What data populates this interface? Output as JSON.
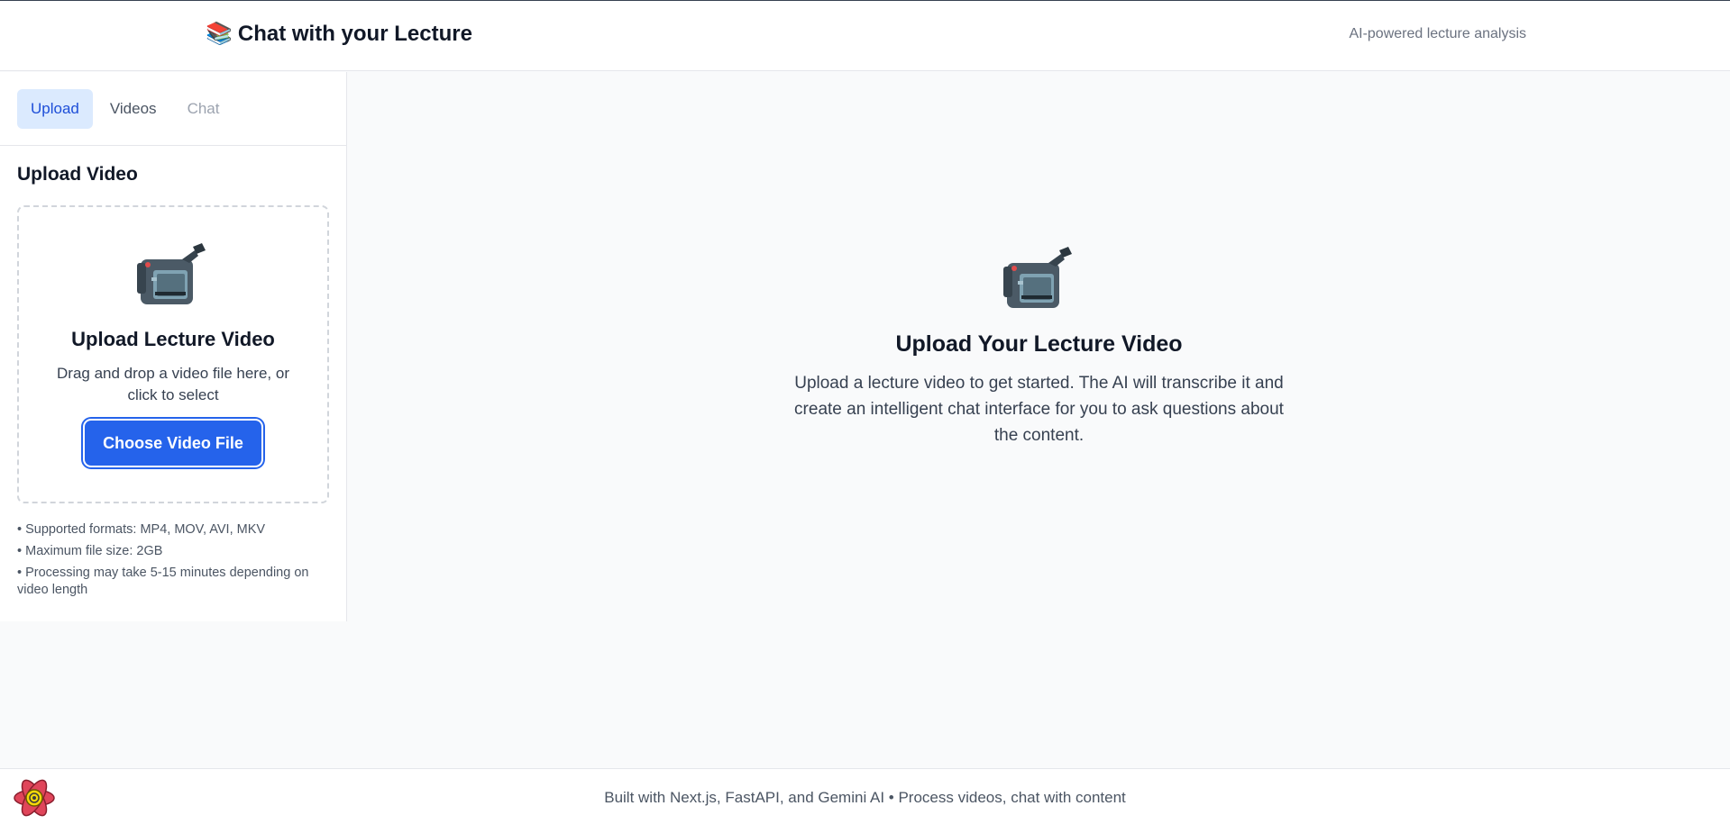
{
  "header": {
    "brand_emoji": "📚",
    "title": "Chat with your Lecture",
    "tagline": "AI-powered lecture analysis"
  },
  "sidebar": {
    "tabs": [
      {
        "label": "Upload",
        "state": "active"
      },
      {
        "label": "Videos",
        "state": "normal"
      },
      {
        "label": "Chat",
        "state": "disabled"
      }
    ],
    "upload": {
      "section_title": "Upload Video",
      "dropzone_icon": "video-camera-icon",
      "dropzone_title": "Upload Lecture Video",
      "dropzone_hint": "Drag and drop a video file here, or click to select",
      "button_label": "Choose Video File",
      "notes": [
        "Supported formats: MP4, MOV, AVI, MKV",
        "Maximum file size: 2GB",
        "Processing may take 5-15 minutes depending on video length"
      ]
    }
  },
  "main": {
    "empty_icon": "video-camera-icon",
    "title": "Upload Your Lecture Video",
    "description": "Upload a lecture video to get started. The AI will transcribe it and create an intelligent chat interface for you to ask questions about the content."
  },
  "footer": {
    "text": "Built with Next.js, FastAPI, and Gemini AI • Process videos, chat with content",
    "corner_icon": "react-devtools-icon"
  },
  "colors": {
    "accent": "#2563eb",
    "active_tab_bg": "#dbeafe",
    "active_tab_text": "#1d4ed8",
    "page_bg": "#f9fafb"
  }
}
